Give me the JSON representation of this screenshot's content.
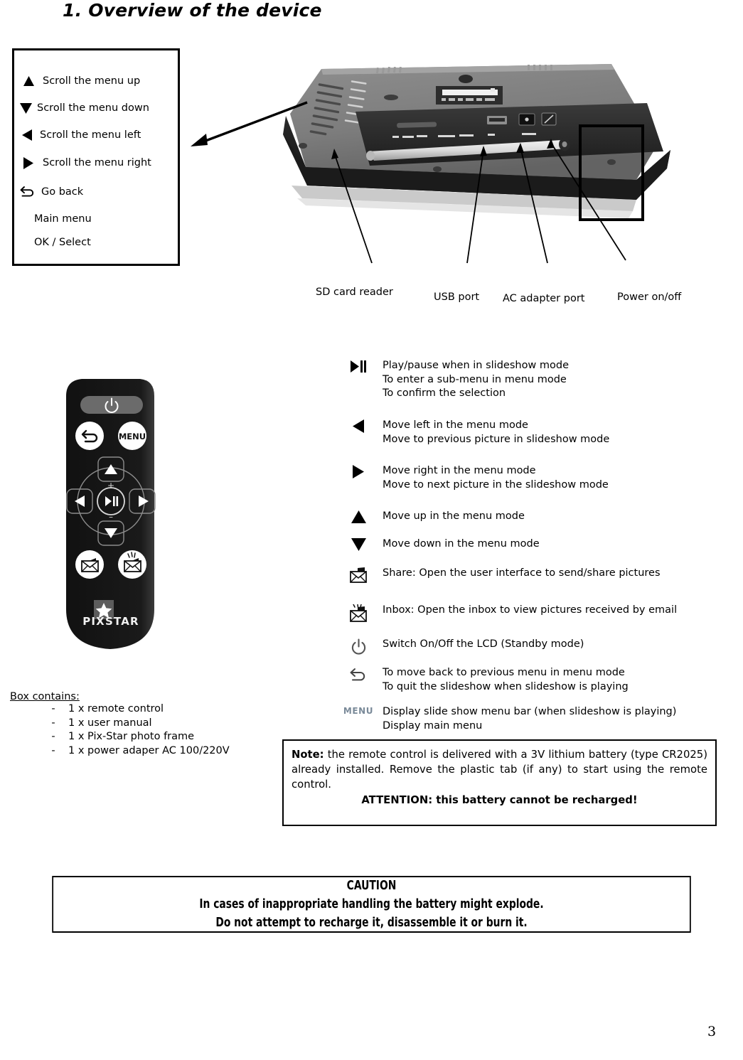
{
  "page": {
    "title": "1. Overview of the device",
    "page_number": "3"
  },
  "key_legend": {
    "rows": [
      {
        "glyph": "triangle-up-icon",
        "text": "Scroll the menu up"
      },
      {
        "glyph": "triangle-down-icon",
        "text": "Scroll the menu down"
      },
      {
        "glyph": "triangle-left-icon",
        "text": "Scroll the menu left"
      },
      {
        "glyph": "triangle-right-icon",
        "text": "Scroll the menu right"
      },
      {
        "glyph": "back-arrow-icon",
        "text": "Go back"
      },
      {
        "glyph": "none",
        "text": "Main menu"
      },
      {
        "glyph": "none",
        "text": "OK / Select"
      }
    ]
  },
  "device_photo": {
    "callout_target": "vent-grill",
    "port_labels": [
      {
        "name": "sd-card-reader",
        "text": "SD card reader"
      },
      {
        "name": "usb-port",
        "text": "USB port"
      },
      {
        "name": "ac-adapter-port",
        "text": "AC adapter port"
      },
      {
        "name": "power-on-off",
        "text": "Power on/off"
      }
    ]
  },
  "remote_control": {
    "brand": "PIXSTAR",
    "buttons": {
      "power": "power-icon",
      "back": "back-arrow-icon",
      "menu": "MENU",
      "up": "triangle-up-icon",
      "down": "triangle-down-icon",
      "left": "triangle-left-icon",
      "right": "triangle-right-icon",
      "center": "play-pause-icon",
      "volume_up_mark": "+",
      "volume_down_mark": "–",
      "share": "share-envelope-icon",
      "inbox": "inbox-envelope-icon"
    }
  },
  "button_functions": [
    {
      "icon": "play-pause-icon",
      "lines": [
        "Play/pause when in slideshow mode",
        "To enter a sub-menu in menu mode",
        "To confirm the selection"
      ]
    },
    {
      "icon": "triangle-left-icon",
      "lines": [
        "Move left in the menu mode",
        "Move to previous picture in slideshow mode"
      ]
    },
    {
      "icon": "triangle-right-icon",
      "lines": [
        "Move right in the menu mode",
        "Move to next picture in the slideshow mode"
      ]
    },
    {
      "icon": "triangle-up-icon",
      "lines": [
        "Move up in the menu mode"
      ]
    },
    {
      "icon": "triangle-down-icon",
      "lines": [
        "Move down in the menu mode"
      ]
    },
    {
      "icon": "share-envelope-icon",
      "lines": [
        "Share: Open the user interface to send/share pictures"
      ]
    },
    {
      "icon": "inbox-envelope-icon",
      "lines": [
        "Inbox: Open the inbox to view pictures received by email"
      ]
    },
    {
      "icon": "power-icon",
      "lines": [
        "Switch On/Off the LCD (Standby mode)"
      ]
    },
    {
      "icon": "back-arrow-icon",
      "lines": [
        "To move back to previous menu in menu mode",
        "To quit the slideshow when slideshow is playing"
      ]
    },
    {
      "icon": "menu-text-icon",
      "menu_label": "MENU",
      "lines": [
        "Display slide show menu bar (when slideshow is playing)",
        "Display main menu"
      ]
    }
  ],
  "box_contains": {
    "title": "Box contains:",
    "dash": "-",
    "items": [
      "1 x remote control",
      "1 x user manual",
      "1 x Pix-Star photo frame",
      "1 x power adaper AC 100/220V"
    ]
  },
  "note_box": {
    "label": "Note:",
    "body": " the remote control is delivered with a 3V lithium battery (type CR2025) already installed. Remove the plastic tab (if any) to start using the remote control.",
    "attention": "ATTENTION: this battery cannot be recharged!"
  },
  "caution_box": {
    "heading": "CAUTION",
    "line1": "In cases of inappropriate handling the battery might explode.",
    "line2": "Do not attempt to recharge it, disassemble it or burn it."
  },
  "colors": {
    "ink": "#000000",
    "paper": "#ffffff",
    "menu_glyph": "#7a8a99",
    "remote_body": "#161616",
    "remote_power_pad": "#6b6b6b"
  }
}
